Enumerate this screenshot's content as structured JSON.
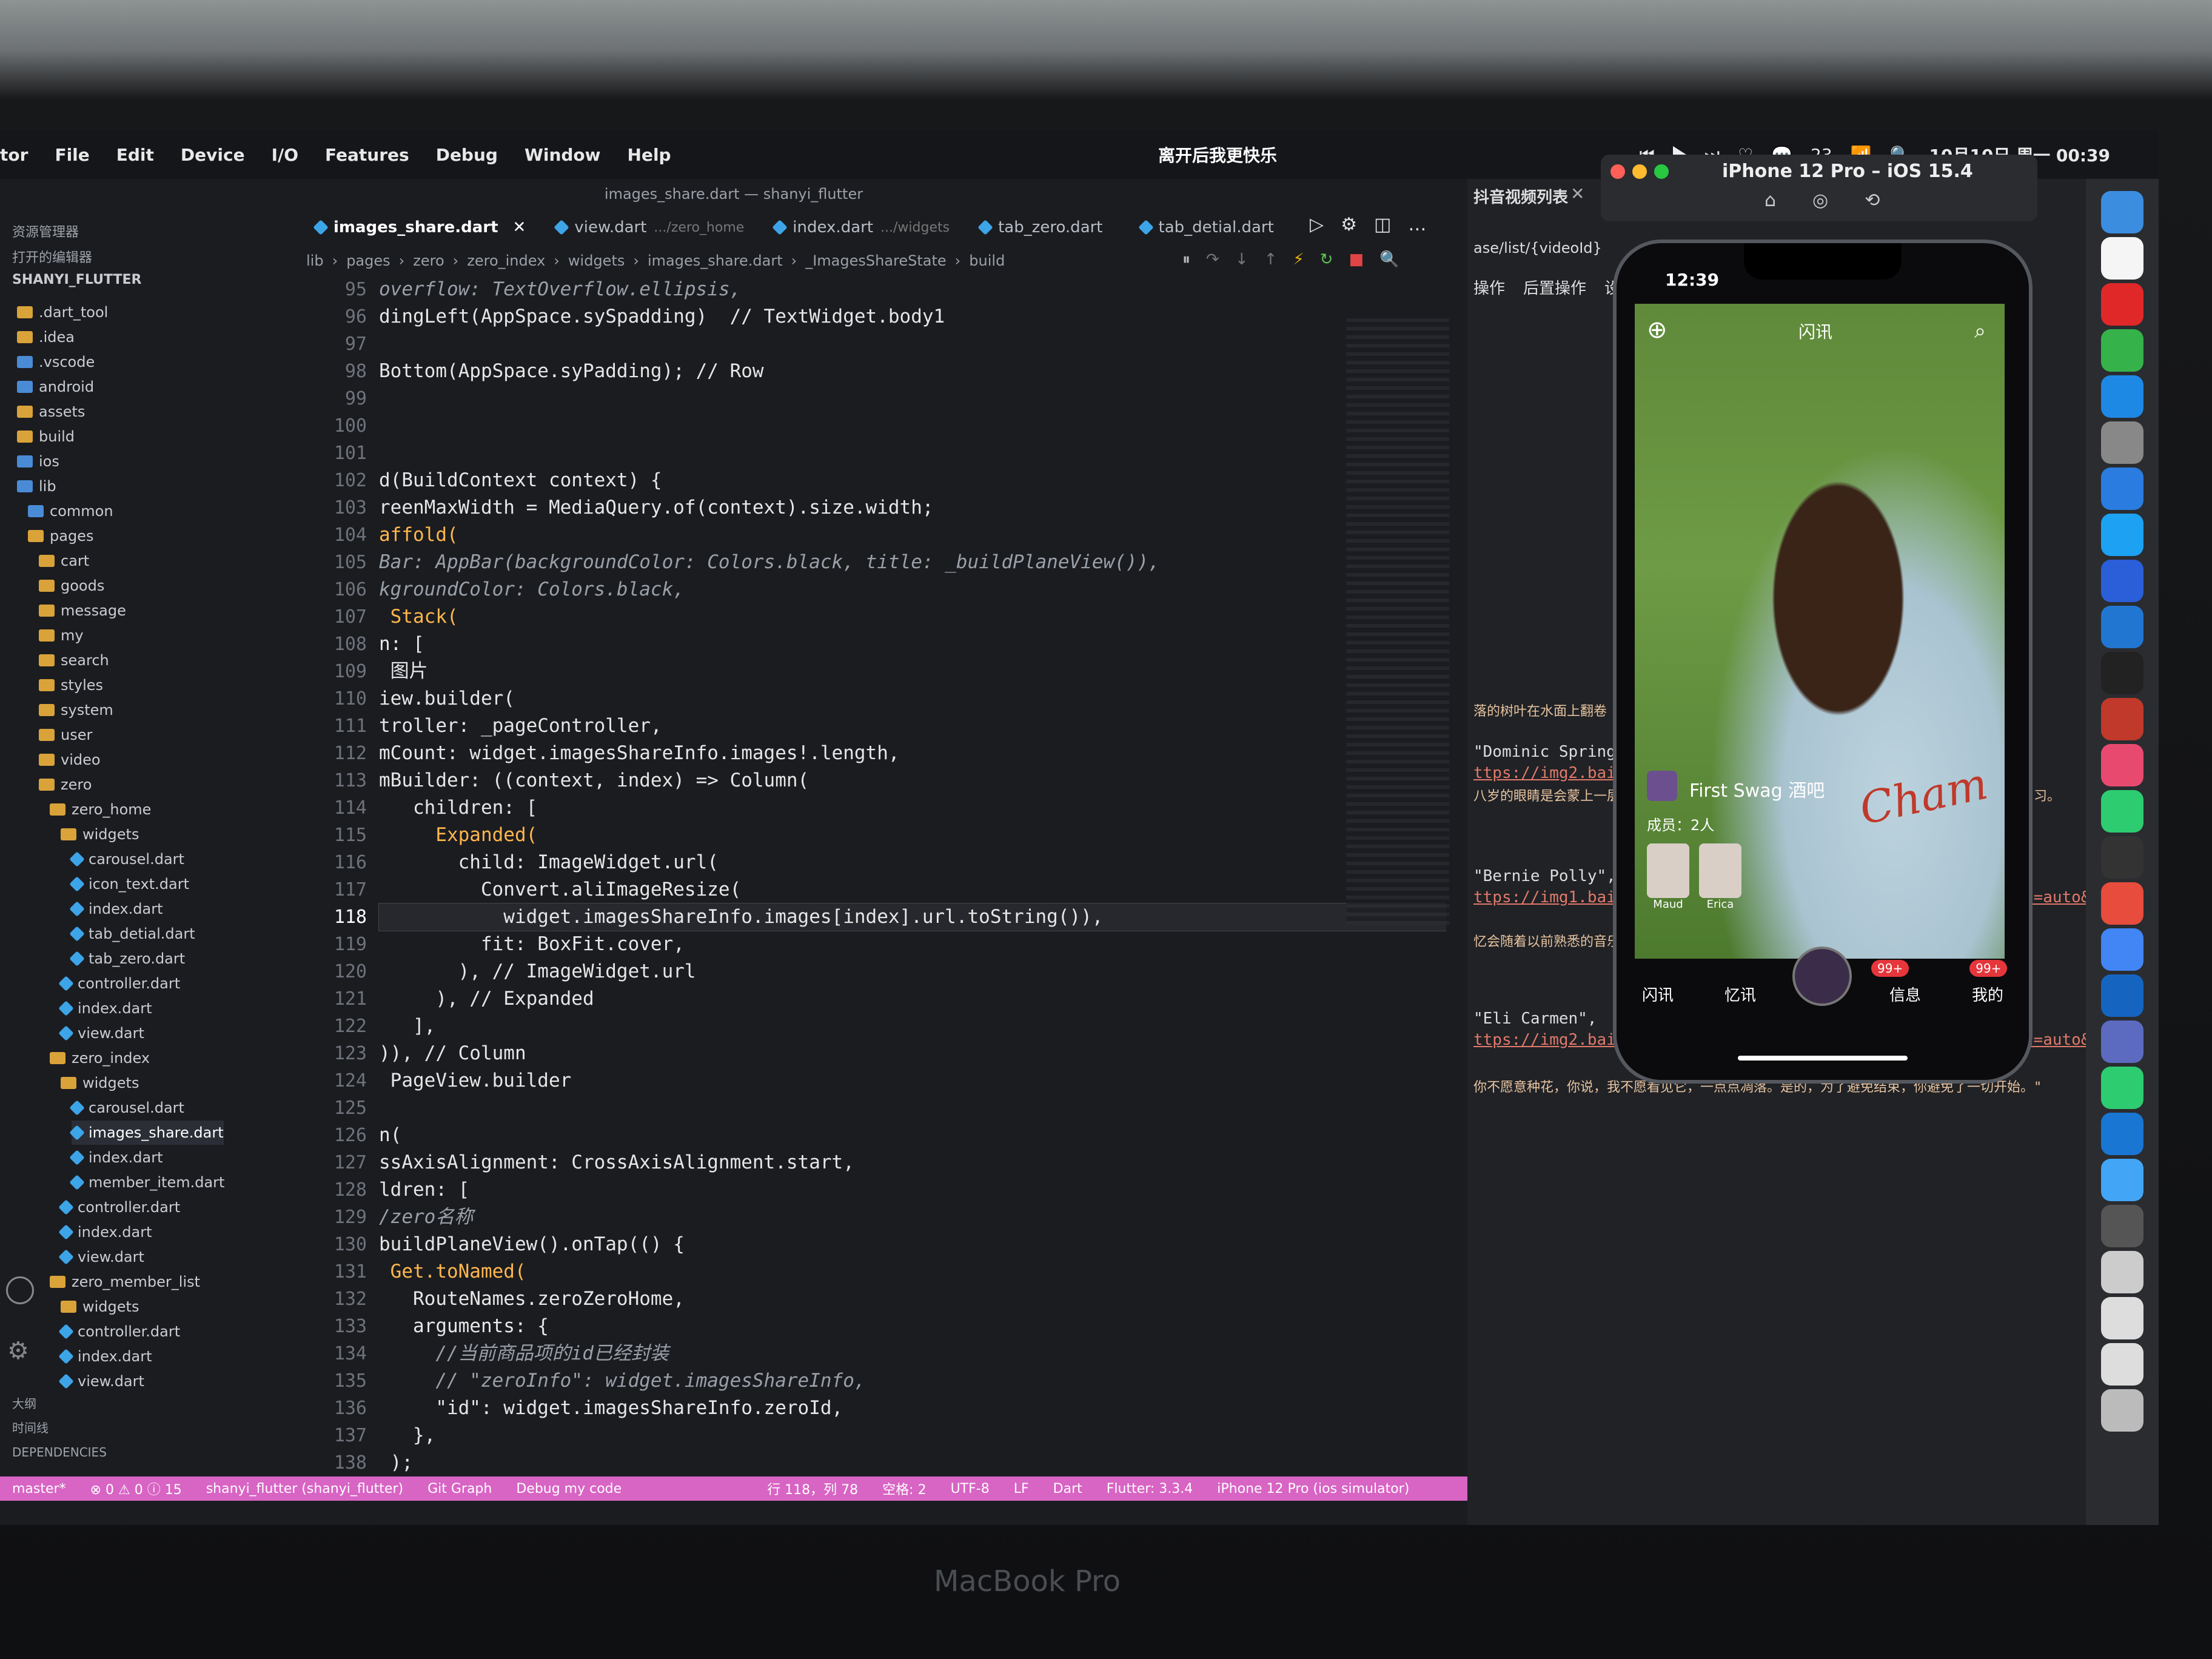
{
  "menubar": {
    "items": [
      "tor",
      "File",
      "Edit",
      "Device",
      "I/O",
      "Features",
      "Debug",
      "Window",
      "Help"
    ],
    "center_text": "离开后我更快乐",
    "wechat_count": "23",
    "datetime": "10月10日 周一 00:39"
  },
  "ide": {
    "window_title": "images_share.dart — shanyi_flutter",
    "sidebar_header": "资源管理器",
    "open_editors": "打开的编辑器",
    "project": "SHANYI_FLUTTER",
    "tree": [
      {
        "label": ".dart_tool",
        "kind": "folder",
        "level": 1
      },
      {
        "label": ".idea",
        "kind": "folder",
        "level": 1
      },
      {
        "label": ".vscode",
        "kind": "folder",
        "level": 1
      },
      {
        "label": "android",
        "kind": "folder",
        "level": 1
      },
      {
        "label": "assets",
        "kind": "folder",
        "level": 1
      },
      {
        "label": "build",
        "kind": "folder",
        "level": 1
      },
      {
        "label": "ios",
        "kind": "folder",
        "level": 1
      },
      {
        "label": "lib",
        "kind": "folder",
        "level": 1
      },
      {
        "label": "common",
        "kind": "folder",
        "level": 2
      },
      {
        "label": "pages",
        "kind": "folder",
        "level": 2
      },
      {
        "label": "cart",
        "kind": "folder",
        "level": 3
      },
      {
        "label": "goods",
        "kind": "folder",
        "level": 3
      },
      {
        "label": "message",
        "kind": "folder",
        "level": 3
      },
      {
        "label": "my",
        "kind": "folder",
        "level": 3
      },
      {
        "label": "search",
        "kind": "folder",
        "level": 3
      },
      {
        "label": "styles",
        "kind": "folder",
        "level": 3
      },
      {
        "label": "system",
        "kind": "folder",
        "level": 3
      },
      {
        "label": "user",
        "kind": "folder",
        "level": 3
      },
      {
        "label": "video",
        "kind": "folder",
        "level": 3
      },
      {
        "label": "zero",
        "kind": "folder",
        "level": 3
      },
      {
        "label": "zero_home",
        "kind": "folder",
        "level": 4
      },
      {
        "label": "widgets",
        "kind": "folder",
        "level": 5
      },
      {
        "label": "carousel.dart",
        "kind": "dart",
        "level": 6
      },
      {
        "label": "icon_text.dart",
        "kind": "dart",
        "level": 6
      },
      {
        "label": "index.dart",
        "kind": "dart",
        "level": 6
      },
      {
        "label": "tab_detial.dart",
        "kind": "dart",
        "level": 6
      },
      {
        "label": "tab_zero.dart",
        "kind": "dart",
        "level": 6
      },
      {
        "label": "controller.dart",
        "kind": "dart",
        "level": 5
      },
      {
        "label": "index.dart",
        "kind": "dart",
        "level": 5
      },
      {
        "label": "view.dart",
        "kind": "dart",
        "level": 5
      },
      {
        "label": "zero_index",
        "kind": "folder",
        "level": 4
      },
      {
        "label": "widgets",
        "kind": "folder",
        "level": 5
      },
      {
        "label": "carousel.dart",
        "kind": "dart",
        "level": 6
      },
      {
        "label": "images_share.dart",
        "kind": "dart",
        "level": 6
      },
      {
        "label": "index.dart",
        "kind": "dart",
        "level": 6
      },
      {
        "label": "member_item.dart",
        "kind": "dart",
        "level": 6
      },
      {
        "label": "controller.dart",
        "kind": "dart",
        "level": 5
      },
      {
        "label": "index.dart",
        "kind": "dart",
        "level": 5
      },
      {
        "label": "view.dart",
        "kind": "dart",
        "level": 5
      },
      {
        "label": "zero_member_list",
        "kind": "folder",
        "level": 4
      },
      {
        "label": "widgets",
        "kind": "folder",
        "level": 5
      },
      {
        "label": "controller.dart",
        "kind": "dart",
        "level": 5
      },
      {
        "label": "index.dart",
        "kind": "dart",
        "level": 5
      },
      {
        "label": "view.dart",
        "kind": "dart",
        "level": 5
      }
    ],
    "bottom_sections": [
      "大纲",
      "时间线",
      "DEPENDENCIES"
    ],
    "tabs": [
      {
        "label": "images_share.dart",
        "hint": ""
      },
      {
        "label": "view.dart",
        "hint": ".../zero_home"
      },
      {
        "label": "index.dart",
        "hint": ".../widgets"
      },
      {
        "label": "tab_zero.dart",
        "hint": ""
      },
      {
        "label": "tab_detial.dart",
        "hint": ""
      }
    ],
    "breadcrumbs": [
      "lib",
      "pages",
      "zero",
      "zero_index",
      "widgets",
      "images_share.dart",
      "_ImagesShareState",
      "build"
    ],
    "line_numbers": [
      "95",
      "96",
      "97",
      "98",
      "99",
      "100",
      "101",
      "102",
      "103",
      "104",
      "105",
      "106",
      "107",
      "108",
      "109",
      "110",
      "111",
      "112",
      "113",
      "114",
      "115",
      "116",
      "117",
      "118",
      "119",
      "120",
      "121",
      "122",
      "123",
      "124",
      "125",
      "126",
      "127",
      "128",
      "129",
      "130",
      "131",
      "132",
      "133",
      "134",
      "135",
      "136",
      "137",
      "138"
    ],
    "code_lines": [
      "overflow: TextOverflow.ellipsis,",
      "dingLeft(AppSpace.sySpadding)  // TextWidget.body1",
      "",
      "Bottom(AppSpace.syPadding); // Row",
      "",
      "",
      "",
      "d(BuildContext context) {",
      "reenMaxWidth = MediaQuery.of(context).size.width;",
      "affold(",
      "Bar: AppBar(backgroundColor: Colors.black, title: _buildPlaneView()),",
      "kgroundColor: Colors.black,",
      " Stack(",
      "n: [",
      " 图片",
      "iew.builder(",
      "troller: _pageController,",
      "mCount: widget.imagesShareInfo.images!.length,",
      "mBuilder: ((context, index) => Column(",
      "   children: [",
      "     Expanded(",
      "       child: ImageWidget.url(",
      "         Convert.aliImageResize(",
      "           widget.imagesShareInfo.images[index].url.toString()),",
      "         fit: BoxFit.cover,",
      "       ), // ImageWidget.url",
      "     ), // Expanded",
      "   ],",
      ")), // Column",
      " PageView.builder",
      "",
      "n(",
      "ssAxisAlignment: CrossAxisAlignment.start,",
      "ldren: [",
      "/zero名称",
      "buildPlaneView().onTap(() {",
      " Get.toNamed(",
      "   RouteNames.zeroZeroHome,",
      "   arguments: {",
      "     //当前商品项的id已经封装",
      "     // \"zeroInfo\": widget.imagesShareInfo,",
      "     \"id\": widget.imagesShareInfo.zeroId,",
      "   },",
      " );"
    ],
    "status": {
      "branch": "master*",
      "problems": "⊗ 0 ⚠ 0 ⓘ 15",
      "project": "shanyi_flutter (shanyi_flutter)",
      "git_graph": "Git Graph",
      "debug": "Debug my code",
      "position": "行 118，列 78",
      "spaces": "空格: 2",
      "encoding": "UTF-8",
      "eol": "LF",
      "lang": "Dart",
      "flutter": "Flutter: 3.3.4",
      "device": "iPhone 12 Pro (ios simulator)"
    }
  },
  "rightpanel": {
    "tab_title": "抖音视频列表",
    "path": "ase/list/{videoId}",
    "toolbar": [
      "操作",
      "后置操作",
      "设"
    ],
    "lines": [
      {
        "text": "落的树叶在水面上翻卷",
        "kind": "zh"
      },
      {
        "text": "\"Dominic Spring\",",
        "kind": "code"
      },
      {
        "text": "ttps://img2.baidu.",
        "kind": "url"
      },
      {
        "text": "八岁的眼睛是会蒙上一层雾水的，有时它会欺骗我们，等到夜深了，我们才能感觉到身上凉风习习。",
        "kind": "zh"
      },
      {
        "text": "\"Bernie Polly\",",
        "kind": "code"
      },
      {
        "text": "ttps://img1.baidu.com/it/u=3714164732,1854373066&fm=253&fmt=auto&app=138",
        "kind": "url"
      },
      {
        "text": "忆会随着以前熟悉的音乐慢慢浮现出来，音乐会封存回忆，是真的。\"",
        "kind": "zh"
      },
      {
        "text": "\"Eli Carmen\",",
        "kind": "code"
      },
      {
        "text": "ttps://img2.baidu.com/it/u=2986260075,1985441267&fm=253&fmt=auto&app=138",
        "kind": "url"
      },
      {
        "text": "你不愿意种花，你说，我不愿看见它，一点点凋落。是的，为了避免结束，你避免了一切开始。\"",
        "kind": "zh"
      }
    ]
  },
  "simulator": {
    "title": "iPhone 12 Pro – iOS 15.4",
    "time": "12:39",
    "header_title": "闪讯",
    "group_name": "First Swag 酒吧",
    "members": "成员：2人",
    "member_names": [
      "Maud",
      "Erica"
    ],
    "tabs": [
      "闪讯",
      "忆讯",
      "",
      "信息",
      "我的"
    ],
    "badges": [
      "99+",
      "99+"
    ],
    "brand": "Cham"
  },
  "laptop_brand": "MacBook Pro",
  "colors": {
    "accent_status": "#d864c4",
    "keyword": "#ffb74d",
    "type": "#f7d35b"
  }
}
